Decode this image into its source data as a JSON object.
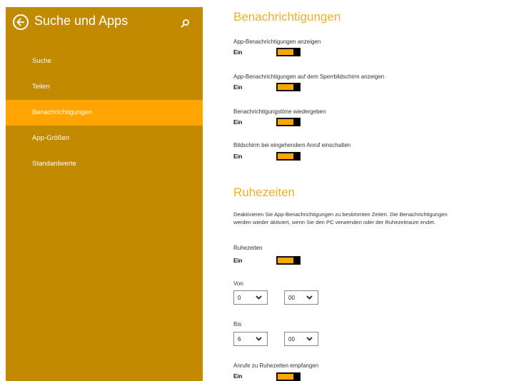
{
  "sidebar": {
    "title": "Suche und Apps",
    "back_icon": "back-arrow-icon",
    "search_icon": "search-icon",
    "items": [
      {
        "label": "Suche",
        "active": false
      },
      {
        "label": "Teilen",
        "active": false
      },
      {
        "label": "Benachrichtigungen",
        "active": true
      },
      {
        "label": "App-Größen",
        "active": false
      },
      {
        "label": "Standardwerte",
        "active": false
      }
    ]
  },
  "notifications": {
    "title": "Benachrichtigungen",
    "settings": [
      {
        "label": "App-Benachrichtigungen anzeigen",
        "state": "Ein",
        "on": true
      },
      {
        "label": "App-Benachrichtigungen auf dem Sperrbildschirm anzeigen",
        "state": "Ein",
        "on": true
      },
      {
        "label": "Benachrichtigungstöne wiedergeben",
        "state": "Ein",
        "on": true
      },
      {
        "label": "Bildschirm bei eingehendem Anruf einschalten",
        "state": "Ein",
        "on": true
      }
    ]
  },
  "quiet_hours": {
    "title": "Ruhezeiten",
    "description_line1": "Deaktivieren Sie App-Benachrichtigungen zu bestimmten Zeiten. Die Benachrichtigungen",
    "description_line2": "werden wieder aktiviert, wenn Sie den PC verwenden oder der Ruhezeitraum endet.",
    "toggle": {
      "label": "Ruhezeiten",
      "state": "Ein",
      "on": true
    },
    "from": {
      "label": "Von",
      "hour": "0",
      "minute": "00"
    },
    "to": {
      "label": "Bis",
      "hour": "6",
      "minute": "00"
    },
    "calls": {
      "label": "Anrufe zu Ruhezeiten empfangen",
      "state": "Ein",
      "on": true
    }
  },
  "colors": {
    "sidebar_bg": "#C28A00",
    "active_item": "#FFA400",
    "heading": "#F2AE2A",
    "toggle_fill": "#FFA400"
  }
}
